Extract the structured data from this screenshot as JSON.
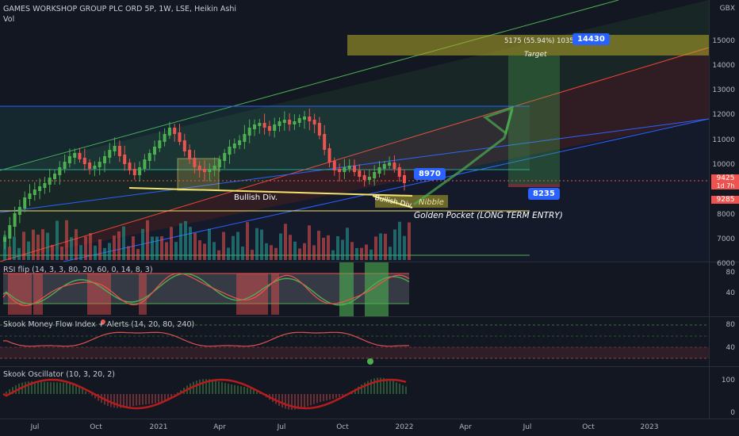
{
  "header": {
    "title": "GAMES WORKSHOP GROUP PLC ORD 5P, 1W, LSE, Heikin Ashi",
    "vol": "Vol",
    "currency": "GBX"
  },
  "price_axis": {
    "ticks": [
      "15000",
      "14000",
      "13000",
      "12000",
      "11000",
      "10000",
      "8000",
      "7000",
      "6000"
    ],
    "current_price": "9425",
    "countdown": "1d 7h",
    "low_price": "9285"
  },
  "rsi_axis": {
    "ticks": [
      "80",
      "40"
    ]
  },
  "mfi_axis": {
    "ticks": [
      "80",
      "40"
    ]
  },
  "osc_axis": {
    "ticks": [
      "100",
      "0"
    ]
  },
  "time_axis": [
    "Jul",
    "Oct",
    "2021",
    "Apr",
    "Jul",
    "Oct",
    "2022",
    "Apr",
    "Jul",
    "Oct",
    "2023"
  ],
  "annotations": {
    "bullish_div_1": "Bullish Div.",
    "bullish_div_2": "Bullish Div.",
    "nibble": "Nibble",
    "golden_pocket": "Golden Pocket (LONG TERM ENTRY)",
    "target_stats": "5175 (55.94%) 1035",
    "target": "Target",
    "tag_entry": "8970",
    "tag_target": "14430",
    "tag_support": "8235"
  },
  "indicators": {
    "rsi": "RSI flip (14, 3, 3, 80, 20, 60, 0, 14, 8, 3)",
    "mfi": "Skook Money Flow Index + Alerts (14, 20, 80, 240)",
    "osc": "Skook Oscillator (10, 3, 20, 2)"
  },
  "colors": {
    "background": "#131722",
    "up": "#26a69a",
    "up_bright": "#4caf50",
    "down": "#ef5350",
    "accent": "#2962ff",
    "channel_green": "#4caf50",
    "channel_red": "#f44336",
    "blue_line": "#2962ff",
    "yellow": "#f5e26b"
  }
}
